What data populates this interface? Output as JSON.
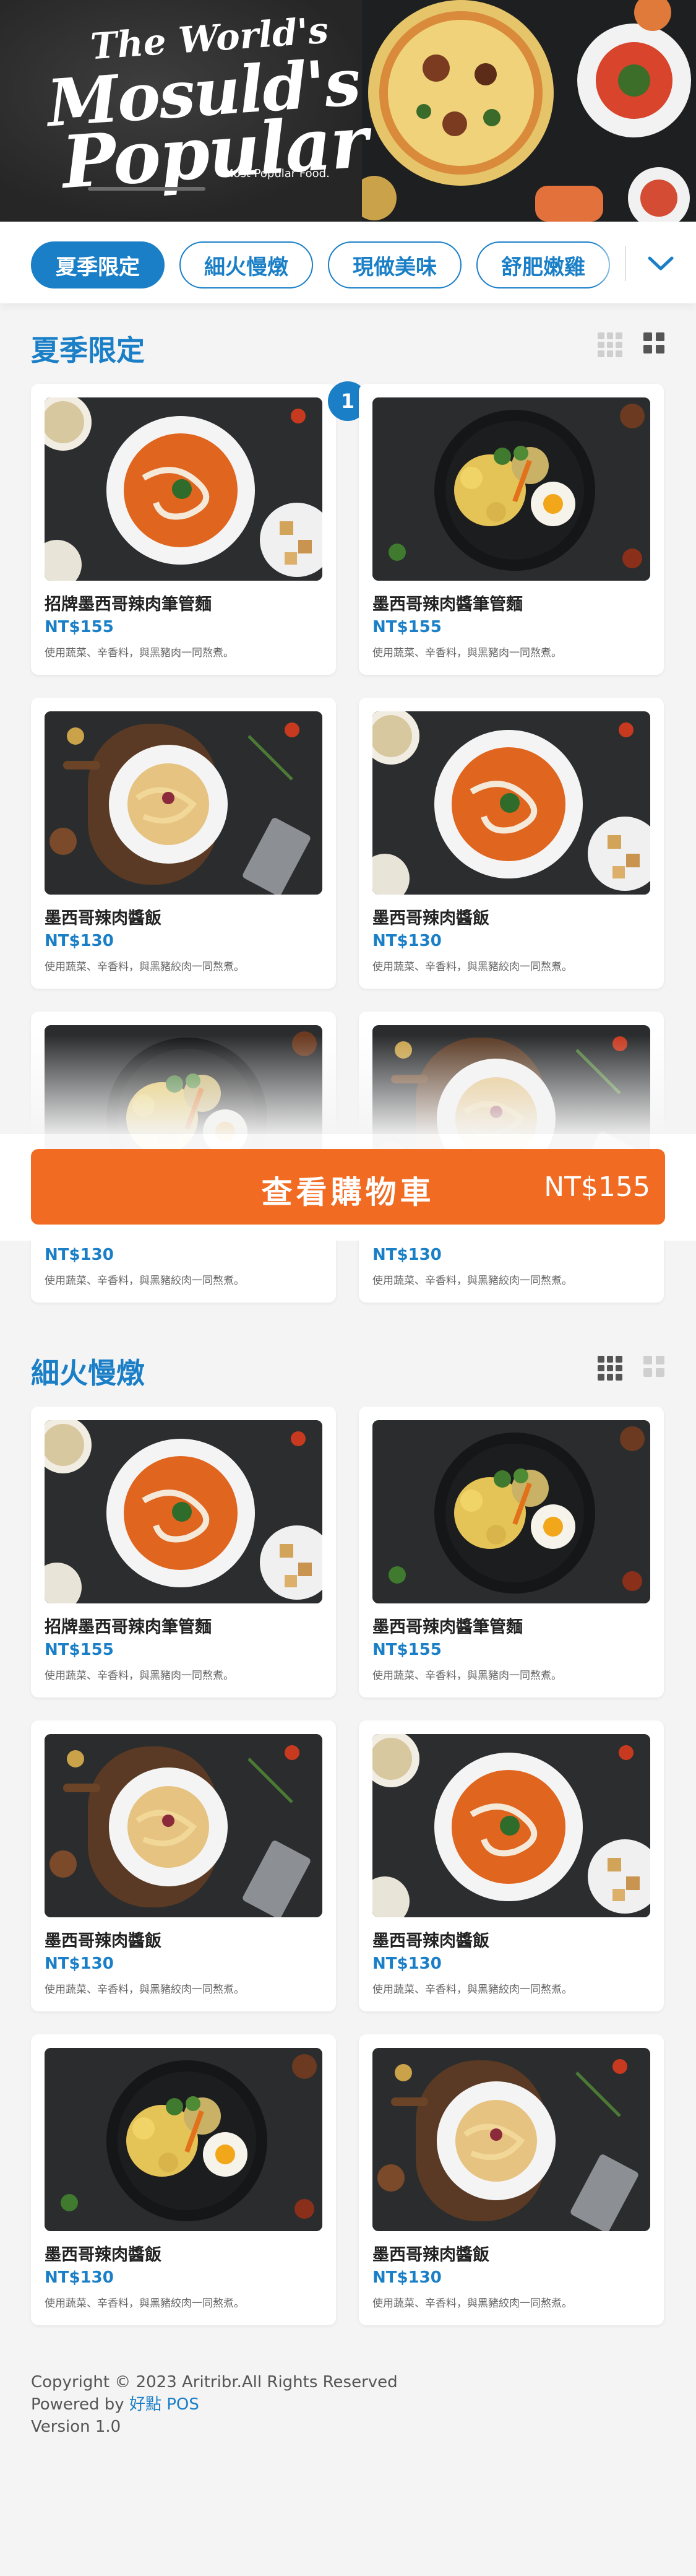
{
  "hero": {
    "line1": "The World's",
    "line2": "Mosuld's",
    "line3": "Popular",
    "tagline": "Most Popular Food."
  },
  "categories": [
    {
      "label": "夏季限定"
    },
    {
      "label": "細火慢燉"
    },
    {
      "label": "現做美味"
    },
    {
      "label": "舒肥嫩雞"
    }
  ],
  "sections": [
    {
      "title": "夏季限定",
      "items": [
        {
          "name": "招牌墨西哥辣肉筆管麵",
          "price": "NT$155",
          "desc": "使用蔬菜、辛香料，與黑豬肉一同熬煮。",
          "image": "tomato-soup",
          "badge": "1"
        },
        {
          "name": "墨西哥辣肉醬筆管麵",
          "price": "NT$155",
          "desc": "使用蔬菜、辛香料，與黑豬肉一同熬煮。",
          "image": "fusilli-egg"
        },
        {
          "name": "墨西哥辣肉醬飯",
          "price": "NT$130",
          "desc": "使用蔬菜、辛香料，與黑豬絞肉一同熬煮。",
          "image": "carbonara"
        },
        {
          "name": "墨西哥辣肉醬飯",
          "price": "NT$130",
          "desc": "使用蔬菜、辛香料，與黑豬絞肉一同熬煮。",
          "image": "tomato-soup"
        },
        {
          "name": "",
          "price": "NT$130",
          "desc": "使用蔬菜、辛香料，與黑豬絞肉一同熬煮。",
          "image": "fusilli-egg"
        },
        {
          "name": "",
          "price": "NT$130",
          "desc": "使用蔬菜、辛香料，與黑豬絞肉一同熬煮。",
          "image": "carbonara"
        }
      ]
    },
    {
      "title": "細火慢燉",
      "items": [
        {
          "name": "招牌墨西哥辣肉筆管麵",
          "price": "NT$155",
          "desc": "使用蔬菜、辛香料，與黑豬肉一同熬煮。",
          "image": "tomato-soup"
        },
        {
          "name": "墨西哥辣肉醬筆管麵",
          "price": "NT$155",
          "desc": "使用蔬菜、辛香料，與黑豬肉一同熬煮。",
          "image": "fusilli-egg"
        },
        {
          "name": "墨西哥辣肉醬飯",
          "price": "NT$130",
          "desc": "使用蔬菜、辛香料，與黑豬絞肉一同熬煮。",
          "image": "carbonara"
        },
        {
          "name": "墨西哥辣肉醬飯",
          "price": "NT$130",
          "desc": "使用蔬菜、辛香料，與黑豬絞肉一同熬煮。",
          "image": "tomato-soup"
        },
        {
          "name": "墨西哥辣肉醬飯",
          "price": "NT$130",
          "desc": "使用蔬菜、辛香料，與黑豬絞肉一同熬煮。",
          "image": "fusilli-egg"
        },
        {
          "name": "墨西哥辣肉醬飯",
          "price": "NT$130",
          "desc": "使用蔬菜、辛香料，與黑豬絞肉一同熬煮。",
          "image": "carbonara"
        }
      ]
    }
  ],
  "cart": {
    "label": "查看購物車",
    "total": "NT$155"
  },
  "footer": {
    "copyright": "Copyright © 2023 Aritribr.All Rights Reserved",
    "powered_prefix": "Powered by ",
    "powered_link": "好點 POS",
    "version": "Version 1.0"
  },
  "colors": {
    "accent": "#1a7fc7",
    "cart": "#f26b22",
    "background": "#f4f4f4"
  }
}
